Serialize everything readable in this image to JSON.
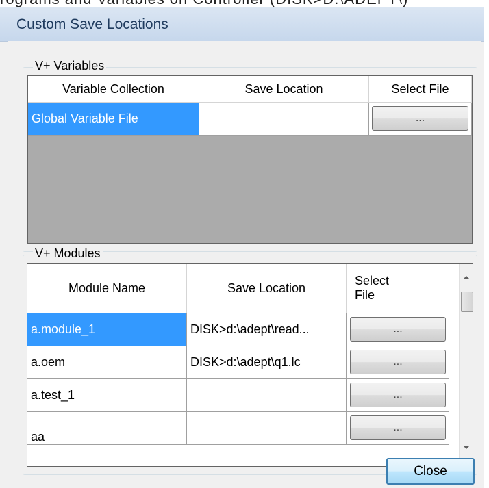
{
  "behind_window": {
    "clipped_title": "rograms and Variables on Controller (DISK>D:\\ADEPT\\)"
  },
  "dialog": {
    "title": "Custom Save Locations",
    "close_label": "Close"
  },
  "variables_group": {
    "label": "V+ Variables",
    "columns": [
      "Variable Collection",
      "Save Location",
      "Select File"
    ],
    "rows": [
      {
        "collection": "Global Variable File",
        "save_location": "",
        "button": "...",
        "selected": true
      }
    ]
  },
  "modules_group": {
    "label": "V+ Modules",
    "columns": [
      "Module Name",
      "Save Location",
      "Select\nFile"
    ],
    "rows": [
      {
        "name": "a.module_1",
        "save_location": "DISK>d:\\adept\\read...",
        "button": "...",
        "selected": true
      },
      {
        "name": "a.oem",
        "save_location": "DISK>d:\\adept\\q1.lc",
        "button": "...",
        "selected": false
      },
      {
        "name": "a.test_1",
        "save_location": "",
        "button": "...",
        "selected": false
      },
      {
        "name": "aa",
        "save_location": "",
        "button": "...",
        "selected": false
      }
    ]
  },
  "icons": {
    "scroll_up": "scroll-up-arrow-icon",
    "scroll_down": "scroll-down-arrow-icon"
  }
}
